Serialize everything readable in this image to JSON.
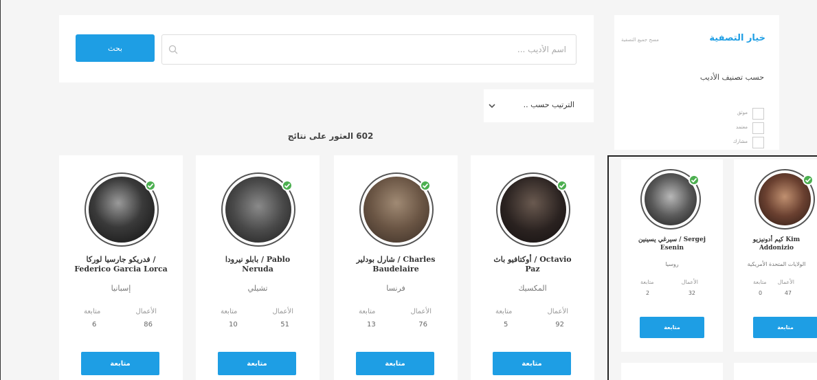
{
  "search": {
    "placeholder": "اسم الأديب ...",
    "button_label": "بحث"
  },
  "sort": {
    "label": "الترتيب حسب .."
  },
  "results": {
    "count_text": "602 العثور على نتائج"
  },
  "filter": {
    "title": "خيار التصفية",
    "hint": "مسح جميع التصفية",
    "section_title": "حسب تصنيف الأديب",
    "options": [
      {
        "label": "موثق"
      },
      {
        "label": "معتمد"
      },
      {
        "label": "مشارك"
      }
    ]
  },
  "colors": {
    "accent": "#1e9ee4",
    "verified": "#4caf50"
  },
  "icons": {
    "search": "search-icon",
    "sort": "chevron-down-icon",
    "verified": "check-icon"
  },
  "authors": [
    {
      "name": "أوكتافيو باث / Octavio\nPaz",
      "country": "المكسيك",
      "works_label": "الأعمال",
      "works": "92",
      "followers_label": "متابعة",
      "followers": "5",
      "follow_label": "متابعة"
    },
    {
      "name": "شارل بودلير / Charles\nBaudelaire",
      "country": "فرنسا",
      "works_label": "الأعمال",
      "works": "76",
      "followers_label": "متابعة",
      "followers": "13",
      "follow_label": "متابعة"
    },
    {
      "name": "بابلو نيرودا / Pablo\nNeruda",
      "country": "تشيلي",
      "works_label": "الأعمال",
      "works": "51",
      "followers_label": "متابعة",
      "followers": "10",
      "follow_label": "متابعة"
    },
    {
      "name": "فدريكو جارسيا لوركا /\nFederico Garcia Lorca",
      "country": "إسبانيا",
      "works_label": "الأعمال",
      "works": "86",
      "followers_label": "متابعة",
      "followers": "6",
      "follow_label": "متابعة"
    }
  ],
  "side_authors": [
    {
      "name": "كيم أدونيزيو Kim\nAddonizio",
      "country": "الولايات المتحدة الأمريكية",
      "works_label": "الأعمال",
      "works": "47",
      "followers_label": "متابعة",
      "followers": "0",
      "follow_label": "متابعة"
    },
    {
      "name": "سيرغي يسينين / Sergej\nEsenin",
      "country": "روسيا",
      "works_label": "الأعمال",
      "works": "32",
      "followers_label": "متابعة",
      "followers": "2",
      "follow_label": "متابعة"
    }
  ]
}
